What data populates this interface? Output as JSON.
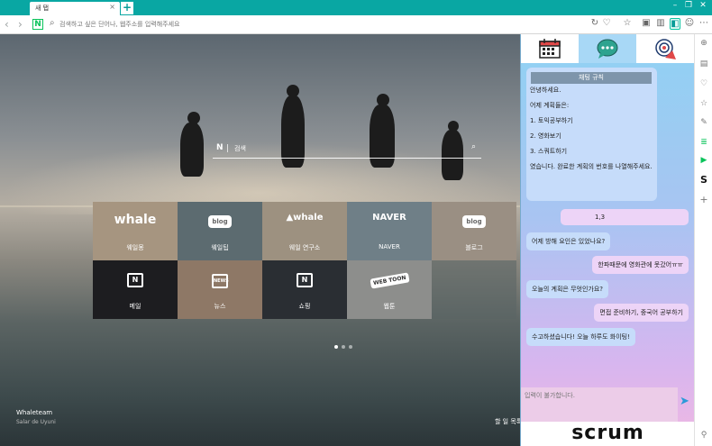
{
  "browser": {
    "tab_title": "새 탭",
    "tab_close": "×",
    "new_tab": "+",
    "window_controls": [
      "–",
      "❐",
      "✕"
    ],
    "address_placeholder": "검색하고 싶은 단어나, 웹주소를 입력해주세요"
  },
  "newtab": {
    "search_label": "검색",
    "search_brand": "N",
    "tiles_row1": [
      {
        "logo": "whale",
        "label": "웨일몽"
      },
      {
        "logo": "blog",
        "label": "웨일팁"
      },
      {
        "logo": "▲whale",
        "label": "웨일 연구소"
      },
      {
        "logo": "NAVER",
        "label": "NAVER"
      },
      {
        "logo": "blog",
        "label": "블로그"
      }
    ],
    "tiles_row2": [
      {
        "logo": "N",
        "label": "메일"
      },
      {
        "logo": "NEWS",
        "label": "뉴스"
      },
      {
        "logo": "N",
        "label": "쇼핑"
      },
      {
        "logo": "WEB TOON",
        "label": "웹툰"
      },
      {
        "logo": "",
        "label": ""
      }
    ],
    "credit_title": "Whaleteam",
    "credit_sub": "Salar de Uyuni",
    "todo_link": "할 일 목록"
  },
  "panel": {
    "rules_title": "채팅 규칙",
    "rules_lines": [
      "안녕하세요.",
      "어제 계획들은:",
      "1. 토익공부하기",
      "2. 영화보기",
      "3. 스쿼트하기",
      "였습니다. 완료한 계획의 번호를 나열해주세요."
    ],
    "messages": [
      {
        "from": "user",
        "text": "1,3"
      },
      {
        "from": "bot",
        "text": "어제 방해 요인은 있었나요?"
      },
      {
        "from": "user",
        "text": "한파때문에 영화관에 못갔어ㅠㅠ"
      },
      {
        "from": "bot",
        "text": "오늘의 계획은 무엇인가요?"
      },
      {
        "from": "user",
        "text": "면접 준비하기, 중국어 공부하기"
      },
      {
        "from": "bot",
        "text": "수고하셨습니다! 오늘 하루도 화이팅!"
      }
    ],
    "input_placeholder": "입력이 불가합니다.",
    "brand": "scrum"
  },
  "colors": {
    "titlebar": "#09a7a3",
    "bot_bubble": "#c6dcfa",
    "user_bubble": "#edd4f7",
    "rules_title_bg": "#7e95ab"
  }
}
